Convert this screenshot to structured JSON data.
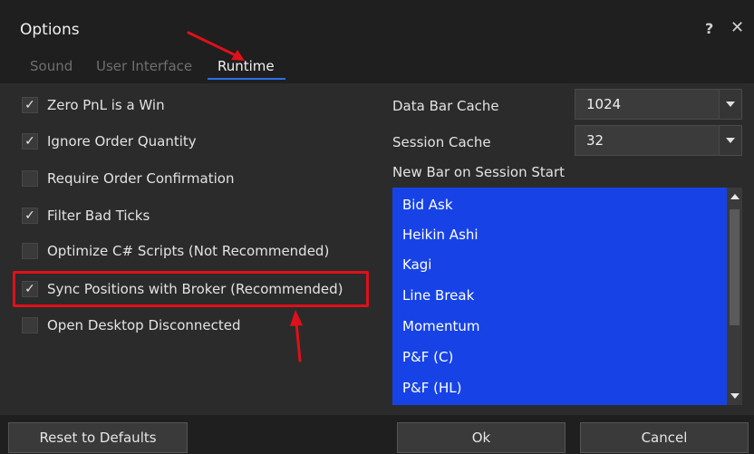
{
  "window": {
    "title": "Options",
    "help_label": "?",
    "close_label": "✕"
  },
  "tabs": [
    {
      "label": "Sound",
      "active": false
    },
    {
      "label": "User Interface",
      "active": false
    },
    {
      "label": "Runtime",
      "active": true
    }
  ],
  "options": [
    {
      "label": "Zero PnL is a Win",
      "checked": true,
      "mark": "✓"
    },
    {
      "label": "Ignore Order Quantity",
      "checked": true,
      "mark": "✓"
    },
    {
      "label": "Require Order Confirmation",
      "checked": false,
      "mark": ""
    },
    {
      "label": "Filter Bad Ticks",
      "checked": true,
      "mark": "✓"
    },
    {
      "label": "Optimize C# Scripts (Not Recommended)",
      "checked": false,
      "mark": ""
    },
    {
      "label": "Sync Positions with Broker (Recommended)",
      "checked": true,
      "mark": "✓"
    },
    {
      "label": "Open Desktop Disconnected",
      "checked": false,
      "mark": ""
    }
  ],
  "data_bar_cache": {
    "label": "Data Bar Cache",
    "value": "1024"
  },
  "session_cache": {
    "label": "Session Cache",
    "value": "32"
  },
  "new_bar_on_session_start": {
    "label": "New Bar on Session Start",
    "items": [
      "Bid Ask",
      "Heikin Ashi",
      "Kagi",
      "Line Break",
      "Momentum",
      "P&F (C)",
      "P&F (HL)"
    ]
  },
  "footer": {
    "reset_label": "Reset to Defaults",
    "ok_label": "Ok",
    "cancel_label": "Cancel"
  },
  "colors": {
    "accent": "#2f6fe6",
    "selection": "#1743e6",
    "annotation": "#e0101a"
  }
}
